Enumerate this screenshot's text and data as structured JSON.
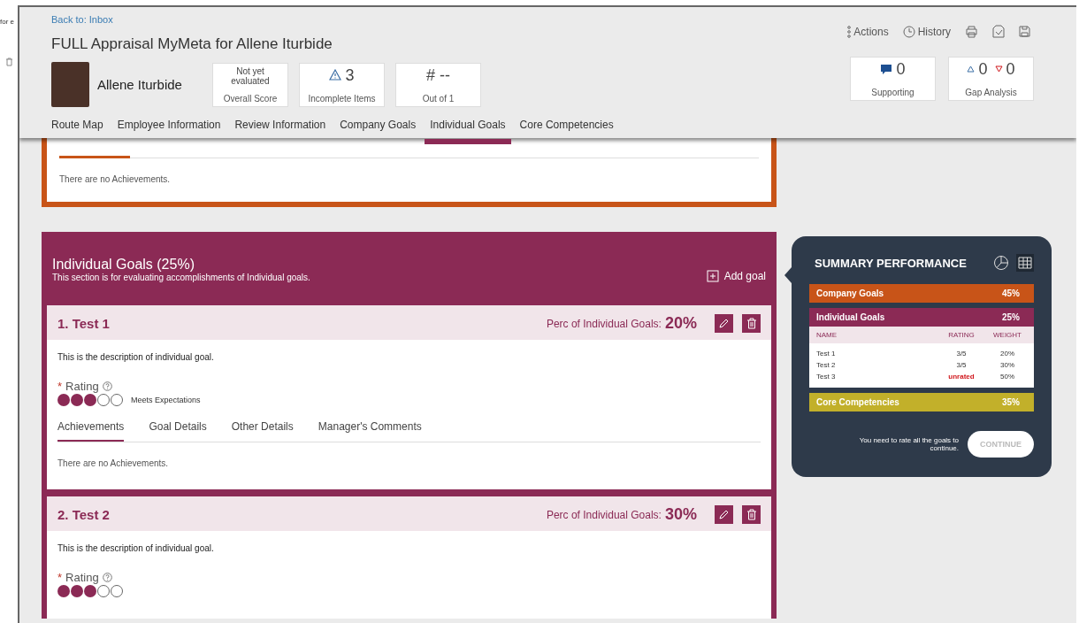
{
  "background_fragment": {
    "text": "for e"
  },
  "header": {
    "back_link": "Back to: Inbox",
    "title": "FULL Appraisal MyMeta for Allene Iturbide",
    "employee_name": "Allene Iturbide",
    "stats": [
      {
        "kind": "text",
        "value": "Not yet evaluated",
        "label": "Overall Score"
      },
      {
        "kind": "warning",
        "value": "3",
        "label": "Incomplete Items"
      },
      {
        "kind": "plain",
        "value": "# --",
        "label": "Out of 1"
      }
    ],
    "actions": [
      {
        "kind": "dots",
        "label": "Actions"
      },
      {
        "kind": "clock",
        "label": "History"
      },
      {
        "kind": "print"
      },
      {
        "kind": "pdf"
      },
      {
        "kind": "save"
      }
    ],
    "right_stats": [
      {
        "kind": "comment",
        "values": [
          "0"
        ],
        "label": "Supporting"
      },
      {
        "kind": "gap",
        "values": [
          "0",
          "0"
        ],
        "label": "Gap Analysis"
      }
    ],
    "tabs": [
      {
        "label": "Route Map",
        "selected": false
      },
      {
        "label": "Employee Information",
        "selected": false
      },
      {
        "label": "Review Information",
        "selected": false
      },
      {
        "label": "Company Goals",
        "selected": false
      },
      {
        "label": "Individual Goals",
        "selected": true
      },
      {
        "label": "Core Competencies",
        "selected": false
      }
    ]
  },
  "previous_card": {
    "empty_text": "There are no Achievements."
  },
  "section": {
    "title": "Individual Goals (25%)",
    "subtitle": "This section is for evaluating accomplishments of Individual goals.",
    "add_label": "Add goal",
    "goals": [
      {
        "title": "1. Test 1",
        "perc_label": "Perc of Individual Goals:",
        "perc": "20%",
        "description": "This is the description of individual goal.",
        "required_mark": "*",
        "rating_label": "Rating",
        "stars": 3,
        "rating_text": "Meets Expectations",
        "tabs": [
          {
            "label": "Achievements",
            "selected": true
          },
          {
            "label": "Goal Details",
            "selected": false
          },
          {
            "label": "Other Details",
            "selected": false
          },
          {
            "label": "Manager's Comments",
            "selected": false
          }
        ],
        "empty_text": "There are no Achievements."
      },
      {
        "title": "2. Test 2",
        "perc_label": "Perc of Individual Goals:",
        "perc": "30%",
        "description": "This is the description of individual goal.",
        "required_mark": "*",
        "rating_label": "Rating",
        "stars": 3
      }
    ]
  },
  "summary": {
    "title": "SUMMARY PERFORMANCE",
    "groups": [
      {
        "name": "Company Goals",
        "percent": "45%",
        "color": "#c85418"
      },
      {
        "name": "Individual Goals",
        "percent": "25%",
        "color": "#8b2a55",
        "columns": [
          "NAME",
          "RATING",
          "WEIGHT"
        ],
        "rows": [
          {
            "name": "Test 1",
            "rating": "3/5",
            "weight": "20%",
            "unrated": false
          },
          {
            "name": "Test 2",
            "rating": "3/5",
            "weight": "30%",
            "unrated": false
          },
          {
            "name": "Test 3",
            "rating": "unrated",
            "weight": "50%",
            "unrated": true
          }
        ]
      },
      {
        "name": "Core Competencies",
        "percent": "35%",
        "color": "#c2b02a"
      }
    ],
    "note": "You need to rate all the goals to continue.",
    "continue_label": "CONTINUE"
  }
}
